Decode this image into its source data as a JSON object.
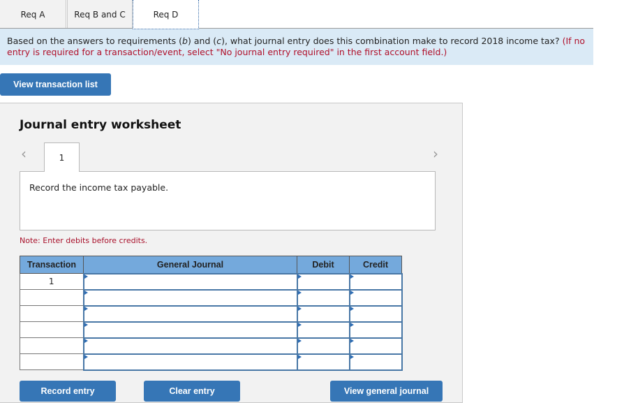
{
  "tabs": [
    {
      "label": "Req A",
      "active": false
    },
    {
      "label": "Req B and C",
      "active": false
    },
    {
      "label": "Req D",
      "active": true
    }
  ],
  "instructions": {
    "main": "Based on the answers to requirements (b) and (c), what journal entry does this combination make to record 2018 income tax?",
    "main_parts": {
      "pre_b": "Based on the answers to requirements (",
      "b": "b",
      "mid": ") and (",
      "c": "c",
      "post": "), what journal entry does this combination make to record 2018 income tax? "
    },
    "note_red": "(If no entry is required for a transaction/event, select \"No journal entry required\" in the first account field.)"
  },
  "buttons": {
    "view_transaction_list": "View transaction list",
    "record_entry": "Record entry",
    "clear_entry": "Clear entry",
    "view_general_journal": "View general journal"
  },
  "worksheet": {
    "title": "Journal entry worksheet",
    "prev_icon": "‹",
    "next_icon": "›",
    "entry_tab": "1",
    "description": "Record the income tax payable.",
    "note": "Note: Enter debits before credits."
  },
  "journal_table": {
    "headers": [
      "Transaction",
      "General Journal",
      "Debit",
      "Credit"
    ],
    "rows": [
      {
        "transaction": "1",
        "account": "",
        "debit": "",
        "credit": ""
      },
      {
        "transaction": "",
        "account": "",
        "debit": "",
        "credit": ""
      },
      {
        "transaction": "",
        "account": "",
        "debit": "",
        "credit": ""
      },
      {
        "transaction": "",
        "account": "",
        "debit": "",
        "credit": ""
      },
      {
        "transaction": "",
        "account": "",
        "debit": "",
        "credit": ""
      },
      {
        "transaction": "",
        "account": "",
        "debit": "",
        "credit": ""
      }
    ]
  },
  "colors": {
    "accent": "#3676b6",
    "table_header": "#74a9dc",
    "instruction_bg": "#daeaf6",
    "warning_red": "#b0102a"
  }
}
